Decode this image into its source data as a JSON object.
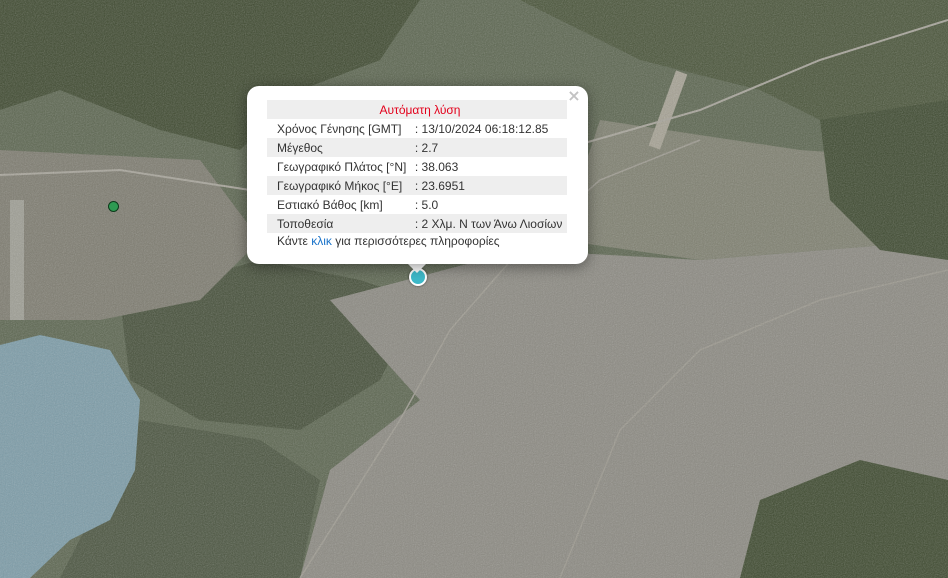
{
  "map": {
    "colors": {
      "sea": "#7a9aa6",
      "urban": "#8a8a80",
      "vegetation": "#3d4a2e",
      "marker_main": "#3fb9c9",
      "marker_small": "#2e9a52"
    }
  },
  "popup": {
    "close_symbol": "×",
    "title": "Αυτόματη λύση",
    "rows": [
      {
        "label": "Χρόνος Γένησης [GMT]",
        "value": ": 13/10/2024 06:18:12.85"
      },
      {
        "label": "Μέγεθος",
        "value": ": 2.7"
      },
      {
        "label": "Γεωγραφικό Πλάτος [°N]",
        "value": ": 38.063"
      },
      {
        "label": "Γεωγραφικό Μήκος [°E]",
        "value": ": 23.6951"
      },
      {
        "label": "Εστιακό Βάθος [km]",
        "value": ": 5.0"
      },
      {
        "label": "Τοποθεσία",
        "value": ": 2 Χλμ. Ν των Άνω Λιοσίων"
      }
    ],
    "more_prefix": "Κάντε ",
    "more_link": "κλικ",
    "more_suffix": " για περισσότερες πληροφορίες"
  }
}
